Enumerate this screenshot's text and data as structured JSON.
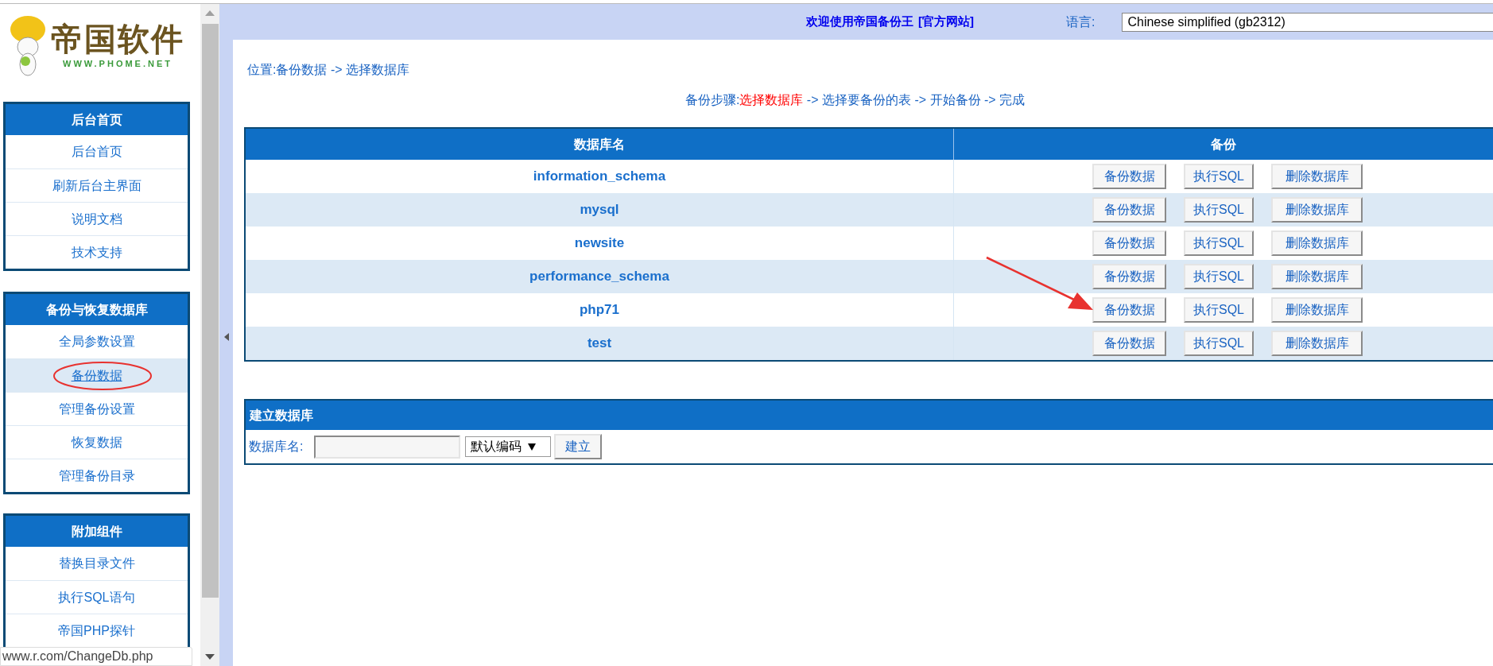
{
  "logo": {
    "title": "帝国软件",
    "url": "WWW.PHOME.NET"
  },
  "sidebar": {
    "menus": [
      {
        "title": "后台首页",
        "items": [
          {
            "label": "后台首页",
            "selected": false
          },
          {
            "label": "刷新后台主界面",
            "selected": false
          },
          {
            "label": "说明文档",
            "selected": false
          },
          {
            "label": "技术支持",
            "selected": false
          }
        ]
      },
      {
        "title": "备份与恢复数据库",
        "items": [
          {
            "label": "全局参数设置",
            "selected": false
          },
          {
            "label": "备份数据",
            "selected": true
          },
          {
            "label": "管理备份设置",
            "selected": false
          },
          {
            "label": "恢复数据",
            "selected": false
          },
          {
            "label": "管理备份目录",
            "selected": false
          }
        ]
      },
      {
        "title": "附加组件",
        "items": [
          {
            "label": "替换目录文件",
            "selected": false
          },
          {
            "label": "执行SQL语句",
            "selected": false
          },
          {
            "label": "帝国PHP探针",
            "selected": false
          }
        ]
      }
    ]
  },
  "status_url": "www.r.com/ChangeDb.php",
  "header": {
    "welcome": "欢迎使用帝国备份王",
    "official_link": "[官方网站]",
    "language_label": "语言:",
    "language_value": "Chinese simplified (gb2312)"
  },
  "location": {
    "label": "位置:",
    "path": [
      "备份数据",
      "选择数据库"
    ],
    "separator": "->"
  },
  "steps": {
    "label": "备份步骤:",
    "separator": "->",
    "items": [
      {
        "label": "选择数据库",
        "selected": true
      },
      {
        "label": "选择要备份的表",
        "selected": false
      },
      {
        "label": "开始备份",
        "selected": false
      },
      {
        "label": "完成",
        "selected": false
      }
    ]
  },
  "table": {
    "columns": [
      "数据库名",
      "备份"
    ],
    "rows": [
      {
        "name": "information_schema",
        "actions": [
          "备份数据",
          "执行SQL",
          "删除数据库"
        ]
      },
      {
        "name": "mysql",
        "actions": [
          "备份数据",
          "执行SQL",
          "删除数据库"
        ]
      },
      {
        "name": "newsite",
        "actions": [
          "备份数据",
          "执行SQL",
          "删除数据库"
        ]
      },
      {
        "name": "performance_schema",
        "actions": [
          "备份数据",
          "执行SQL",
          "删除数据库"
        ]
      },
      {
        "name": "php71",
        "actions": [
          "备份数据",
          "执行SQL",
          "删除数据库"
        ]
      },
      {
        "name": "test",
        "actions": [
          "备份数据",
          "执行SQL",
          "删除数据库"
        ]
      }
    ]
  },
  "create_db": {
    "title": "建立数据库",
    "field_label": "数据库名:",
    "encoding": "默认编码",
    "button": "建立"
  }
}
